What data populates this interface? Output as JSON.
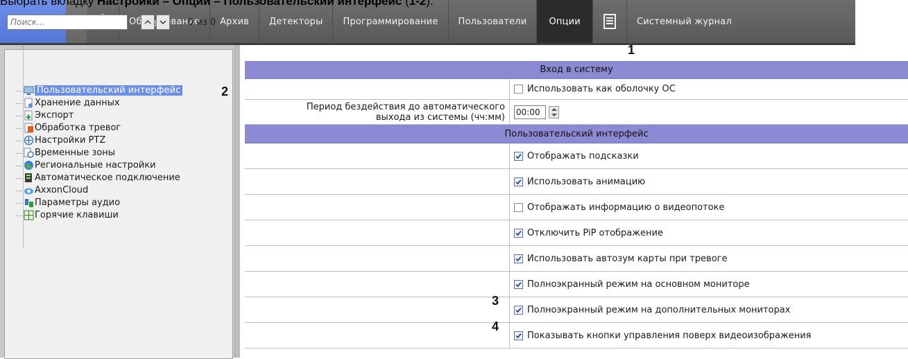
{
  "caption": {
    "prefix": "Выбрать вкладку ",
    "path": "Настройки – Опции – Пользовательский интерфейс",
    "refs_open": " (",
    "refs": "1-2",
    "refs_close": ")."
  },
  "toolbar": {
    "tabs": [
      "Оборудование",
      "Архив",
      "Детекторы",
      "Программирование",
      "Пользователи",
      "Опции"
    ],
    "journal_label": "Системный журнал",
    "active_tab": "Опции"
  },
  "left": {
    "search_placeholder": "Поиск...",
    "count": "0 из 0",
    "tree": [
      {
        "label": "Пользовательский интерфейс",
        "icon": "monitor-icon"
      },
      {
        "label": "Хранение данных",
        "icon": "storage-icon"
      },
      {
        "label": "Экспорт",
        "icon": "export-icon"
      },
      {
        "label": "Обработка тревог",
        "icon": "alarm-icon"
      },
      {
        "label": "Настройки PTZ",
        "icon": "ptz-icon"
      },
      {
        "label": "Временные зоны",
        "icon": "clock-icon"
      },
      {
        "label": "Региональные настройки",
        "icon": "globe-icon"
      },
      {
        "label": "Автоматическое подключение",
        "icon": "server-icon"
      },
      {
        "label": "AxxonCloud",
        "icon": "cloud-icon"
      },
      {
        "label": "Параметры аудио",
        "icon": "audio-icon"
      },
      {
        "label": "Горячие клавиши",
        "icon": "keyboard-icon"
      }
    ]
  },
  "markers": {
    "m1": "1",
    "m2": "2",
    "m3": "3",
    "m4": "4"
  },
  "grid": {
    "section1": "Вход в систему",
    "use_shell": "Использовать как оболочку ОС",
    "idle_label_1": "Период бездействия до автоматического",
    "idle_label_2": "выхода из системы (чч:мм)",
    "idle_value": "00:00",
    "section2": "Пользовательский интерфейс",
    "options": [
      {
        "label": "Отображать подсказки",
        "checked": true
      },
      {
        "label": "Использовать анимацию",
        "checked": true
      },
      {
        "label": "Отображать информацию о видеопотоке",
        "checked": false
      },
      {
        "label": "Отключить PiP отображение",
        "checked": true
      },
      {
        "label": "Использовать автозум карты при тревоге",
        "checked": true
      },
      {
        "label": "Полноэкранный режим на основном мониторе",
        "checked": true
      },
      {
        "label": "Полноэкранный режим на дополнительных мониторах",
        "checked": true
      },
      {
        "label": "Показывать кнопки управления поверх видеоизображения",
        "checked": true
      }
    ]
  }
}
